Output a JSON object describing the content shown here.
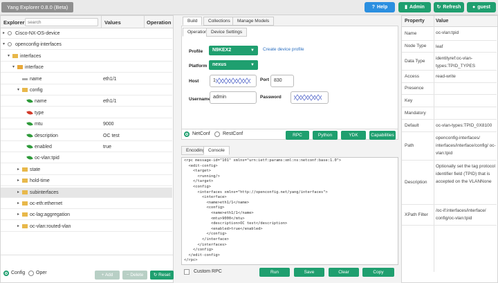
{
  "header": {
    "app_title": "Yang Explorer 0.8.0 (Beta)",
    "help": "Help",
    "admin": "Admin",
    "refresh": "Refresh",
    "user": "guest"
  },
  "explorer": {
    "heading": "Explorer",
    "search_placeholder": "search",
    "col_values": "Values",
    "col_operation": "Operation",
    "nodes": [
      {
        "label": "Cisco-NX-OS-device",
        "value": "",
        "toggle": "▸",
        "icon": "module-icon",
        "indent": 0
      },
      {
        "label": "openconfig-interfaces",
        "value": "",
        "toggle": "▾",
        "icon": "module-icon",
        "indent": 0
      },
      {
        "label": "interfaces",
        "value": "",
        "toggle": "▾",
        "icon": "folder-icon",
        "indent": 1
      },
      {
        "label": "interface",
        "value": "",
        "toggle": "▾",
        "icon": "list-icon",
        "indent": 2
      },
      {
        "label": "name",
        "value": "eth1/1",
        "toggle": "",
        "icon": "key-icon",
        "indent": 3
      },
      {
        "label": "config",
        "value": "",
        "toggle": "▾",
        "icon": "folder-icon",
        "indent": 3
      },
      {
        "label": "name",
        "value": "eth1/1",
        "toggle": "",
        "icon": "leaf-green-icon",
        "indent": 4
      },
      {
        "label": "type",
        "value": "",
        "toggle": "",
        "icon": "leaf-red-icon",
        "indent": 4
      },
      {
        "label": "mtu",
        "value": "9000",
        "toggle": "",
        "icon": "leaf-green-icon",
        "indent": 4
      },
      {
        "label": "description",
        "value": "OC test",
        "toggle": "",
        "icon": "leaf-green-icon",
        "indent": 4
      },
      {
        "label": "enabled",
        "value": "true",
        "toggle": "",
        "icon": "leaf-green-icon",
        "indent": 4
      },
      {
        "label": "oc-vlan:tpid",
        "value": "",
        "toggle": "",
        "icon": "leaf-green-icon",
        "indent": 4
      },
      {
        "label": "state",
        "value": "",
        "toggle": "▸",
        "icon": "folder-icon",
        "indent": 3
      },
      {
        "label": "hold-time",
        "value": "",
        "toggle": "▸",
        "icon": "folder-icon",
        "indent": 3
      },
      {
        "label": "subinterfaces",
        "value": "",
        "toggle": "▸",
        "icon": "folder-icon",
        "indent": 3
      },
      {
        "label": "oc-eth:ethernet",
        "value": "",
        "toggle": "▸",
        "icon": "folder-icon",
        "indent": 3
      },
      {
        "label": "oc-lag:aggregation",
        "value": "",
        "toggle": "▸",
        "icon": "folder-icon",
        "indent": 3
      },
      {
        "label": "oc-vlan:routed-vlan",
        "value": "",
        "toggle": "▸",
        "icon": "folder-icon",
        "indent": 3
      }
    ],
    "mode_config": "Config",
    "mode_oper": "Oper",
    "add": "Add",
    "delete": "Delete",
    "reset": "Reset"
  },
  "center": {
    "tabs": [
      "Build",
      "Collections",
      "Manage Models"
    ],
    "subtabs": [
      "Operations",
      "Device Settings"
    ],
    "profile_label": "Profile",
    "profile_value": "N9KEX2",
    "create_profile": "Create device profile",
    "platform_label": "Platform",
    "platform_value": "nexus",
    "host_label": "Host",
    "host_value": "1",
    "port_label": "Port",
    "port_value": "830",
    "username_label": "Username",
    "username_value": "admin",
    "password_label": "Password",
    "protocol_netconf": "NetConf",
    "protocol_restconf": "RestConf",
    "action_buttons": [
      "RPC",
      "Python",
      "YDK",
      "Capabilities"
    ],
    "editor_tabs": [
      "Encoding",
      "Console"
    ],
    "rpc_text": "<rpc message-id=\"101\" xmlns=\"urn:ietf:params:xml:ns:netconf:base:1.0\">\n  <edit-config>\n    <target>\n      <running/>\n    </target>\n    <config>\n      <interfaces xmlns=\"http://openconfig.net/yang/interfaces\">\n        <interface>\n          <name>eth1/1</name>\n          <config>\n            <name>eth1/1</name>\n            <mtu>9000</mtu>\n            <description>OC test</description>\n            <enabled>true</enabled>\n          </config>\n        </interface>\n      </interfaces>\n    </config>\n  </edit-config>\n</rpc>",
    "custom_rpc": "Custom RPC",
    "run": "Run",
    "save": "Save",
    "clear": "Clear",
    "copy": "Copy"
  },
  "properties": {
    "col_property": "Property",
    "col_value": "Value",
    "rows": [
      {
        "key": "Name",
        "value": "oc-vlan:tpid",
        "h": 20
      },
      {
        "key": "Node Type",
        "value": "leaf",
        "h": 17
      },
      {
        "key": "Data Type",
        "value": "identityref:oc-vlan-types:TPID_TYPES",
        "h": 26
      },
      {
        "key": "Access",
        "value": "read-write",
        "h": 18
      },
      {
        "key": "Presence",
        "value": "",
        "h": 17
      },
      {
        "key": "Key",
        "value": "",
        "h": 18
      },
      {
        "key": "Mandatory",
        "value": "",
        "h": 18
      },
      {
        "key": "Default",
        "value": "oc-vlan-types:TPID_0X8100",
        "h": 18
      },
      {
        "key": "Path",
        "value": "openconfig-interfaces/ interfaces/interface/config/ oc-vlan:tpid",
        "h": 41
      },
      {
        "key": "Description",
        "value": "Optionally set the tag protocol identifier field (TPID) that is accepted on the VLANNone",
        "h": 64
      },
      {
        "key": "XPath Filter",
        "value": "/oc-if:interfaces/interface/ config/oc-vlan:tpid",
        "h": 30
      }
    ]
  },
  "colors": {
    "green": "#1f9f6f",
    "blue": "#2b8fe0",
    "title_gray": "#8f8f8f"
  }
}
